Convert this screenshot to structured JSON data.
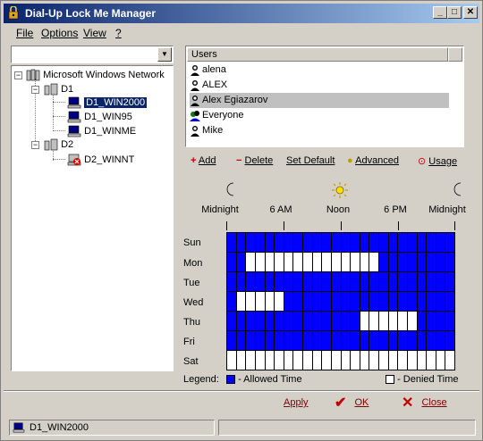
{
  "window": {
    "title": "Dial-Up Lock Me Manager",
    "controls": [
      "_",
      "□",
      "✕"
    ]
  },
  "menu": [
    "File",
    "Options",
    "View",
    "?"
  ],
  "tree": {
    "root": "Microsoft Windows Network",
    "group1": "D1",
    "group1_items": [
      "D1_WIN2000",
      "D1_WIN95",
      "D1_WINME"
    ],
    "group2": "D2",
    "group2_items": [
      "D2_WINNT"
    ],
    "selected": "D1_WIN2000"
  },
  "users": {
    "header": "Users",
    "items": [
      "alena",
      "ALEX",
      "Alex Egiazarov",
      "Everyone",
      "Mike"
    ],
    "selected_index": 2
  },
  "actions": {
    "add": "Add",
    "delete": "Delete",
    "set_default": "Set Default",
    "advanced": "Advanced",
    "usage": "Usage"
  },
  "schedule": {
    "time_labels": [
      "Midnight",
      "6 AM",
      "Noon",
      "6 PM",
      "Midnight"
    ],
    "days": [
      "Sun",
      "Mon",
      "Tue",
      "Wed",
      "Thu",
      "Fri",
      "Sat"
    ],
    "hours": 24,
    "denied": {
      "Sun": [],
      "Mon": [
        2,
        3,
        4,
        5,
        6,
        7,
        8,
        9,
        10,
        11,
        12,
        13,
        14,
        15
      ],
      "Tue": [],
      "Wed": [
        1,
        2,
        3,
        4,
        5
      ],
      "Thu": [
        14,
        15,
        16,
        17,
        18,
        19
      ],
      "Fri": [],
      "Sat": [
        0,
        1,
        2,
        3,
        4,
        5,
        6,
        7,
        8,
        9,
        10,
        11,
        12,
        13,
        14,
        15,
        16,
        17,
        18,
        19,
        20,
        21,
        22,
        23
      ]
    },
    "allowed_color": "#0000ff",
    "denied_color": "#ffffff"
  },
  "legend": {
    "label": "Legend:",
    "allowed": "- Allowed Time",
    "denied": "- Denied Time"
  },
  "buttons": {
    "apply": "Apply",
    "ok": "OK",
    "close": "Close"
  },
  "status": {
    "computer": "D1_WIN2000"
  }
}
